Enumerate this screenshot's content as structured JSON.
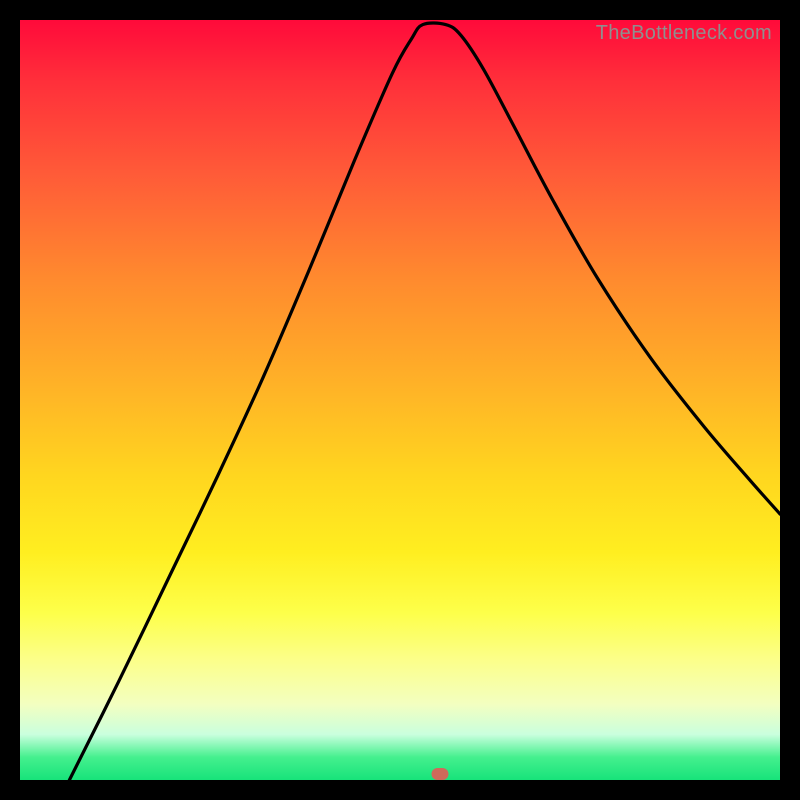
{
  "watermark": "TheBottleneck.com",
  "marker": {
    "x_pct": 55.3,
    "y_pct": 99.2
  },
  "chart_data": {
    "type": "line",
    "title": "",
    "xlabel": "",
    "ylabel": "",
    "xlim_pct": [
      0,
      100
    ],
    "ylim_pct": [
      0,
      100
    ],
    "curve_points_pct": [
      {
        "x": 6.5,
        "y": 0.0
      },
      {
        "x": 13.0,
        "y": 13.0
      },
      {
        "x": 20.0,
        "y": 27.5
      },
      {
        "x": 26.0,
        "y": 40.0
      },
      {
        "x": 32.0,
        "y": 53.0
      },
      {
        "x": 38.0,
        "y": 67.0
      },
      {
        "x": 44.0,
        "y": 81.5
      },
      {
        "x": 49.0,
        "y": 93.0
      },
      {
        "x": 51.5,
        "y": 97.5
      },
      {
        "x": 53.0,
        "y": 99.4
      },
      {
        "x": 56.0,
        "y": 99.4
      },
      {
        "x": 58.0,
        "y": 98.0
      },
      {
        "x": 61.0,
        "y": 93.5
      },
      {
        "x": 65.0,
        "y": 86.0
      },
      {
        "x": 70.0,
        "y": 76.5
      },
      {
        "x": 76.0,
        "y": 66.0
      },
      {
        "x": 83.0,
        "y": 55.5
      },
      {
        "x": 90.0,
        "y": 46.5
      },
      {
        "x": 96.0,
        "y": 39.5
      },
      {
        "x": 100.0,
        "y": 35.0
      }
    ],
    "gradient_stops": [
      {
        "offset": 0,
        "color": "#ff0a3a"
      },
      {
        "offset": 8,
        "color": "#ff2f3a"
      },
      {
        "offset": 20,
        "color": "#ff5a38"
      },
      {
        "offset": 34,
        "color": "#ff8a2e"
      },
      {
        "offset": 48,
        "color": "#ffb227"
      },
      {
        "offset": 60,
        "color": "#ffd61f"
      },
      {
        "offset": 70,
        "color": "#ffee20"
      },
      {
        "offset": 78,
        "color": "#fdff4a"
      },
      {
        "offset": 84,
        "color": "#fcff88"
      },
      {
        "offset": 90,
        "color": "#f3ffc0"
      },
      {
        "offset": 94,
        "color": "#caffde"
      },
      {
        "offset": 97,
        "color": "#45f08e"
      },
      {
        "offset": 100,
        "color": "#17e37a"
      }
    ]
  }
}
